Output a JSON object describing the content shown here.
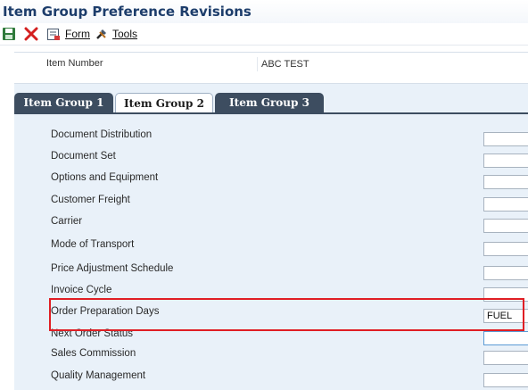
{
  "window": {
    "title": "Item Group Preference Revisions"
  },
  "toolbar": {
    "save_icon": "save-icon",
    "close_icon": "close-icon",
    "form_label": "Form",
    "tools_label": "Tools"
  },
  "header": {
    "item_number_label": "Item Number",
    "item_number_value": "ABC TEST"
  },
  "tabs": [
    {
      "label": "Item Group 1"
    },
    {
      "label": "Item Group 2"
    },
    {
      "label": "Item Group 3"
    }
  ],
  "active_tab": "Item Group 2",
  "fields": [
    {
      "label": "Document Distribution",
      "value": ""
    },
    {
      "label": "Document Set",
      "value": ""
    },
    {
      "label": "Options and Equipment",
      "value": ""
    },
    {
      "label": "Customer Freight",
      "value": ""
    },
    {
      "label": "Carrier",
      "value": ""
    },
    {
      "label": "Mode of Transport",
      "value": ""
    },
    {
      "label": "Price Adjustment Schedule",
      "value": ""
    },
    {
      "label": "Invoice Cycle",
      "value": ""
    },
    {
      "label": "Order Preparation Days",
      "value": "FUEL"
    },
    {
      "label": "Next Order Status",
      "value": ""
    },
    {
      "label": "Sales Commission",
      "value": ""
    },
    {
      "label": "Quality Management",
      "value": ""
    }
  ],
  "colors": {
    "title_text": "#1d3d6b",
    "tab_inactive": "#3d4d60",
    "panel_bg": "#e9f1f9",
    "highlight_border": "#e01e24"
  }
}
